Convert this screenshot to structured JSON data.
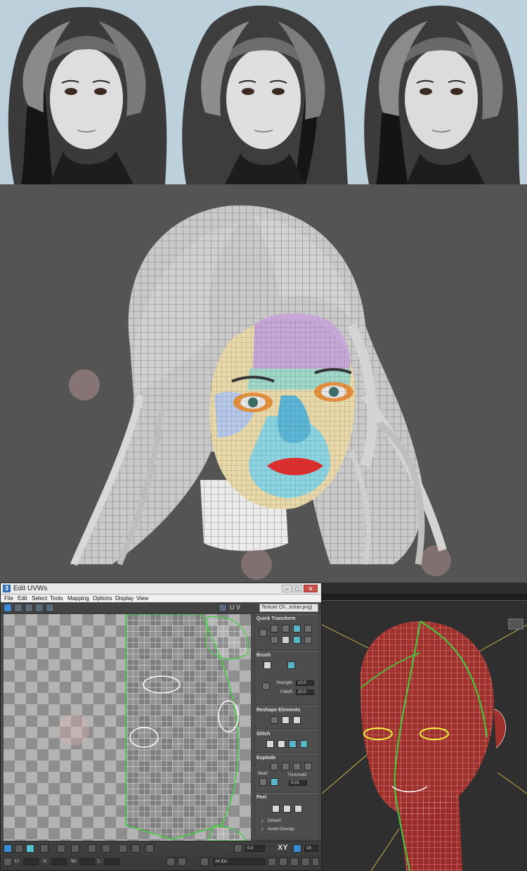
{
  "window": {
    "title": "Edit UVWs",
    "app_icon": "3",
    "buttons": {
      "minimize": "–",
      "maximize": "□",
      "close": "✕"
    }
  },
  "menu": [
    "File",
    "Edit",
    "Select",
    "Tools",
    "Mapping",
    "Options",
    "Display",
    "View"
  ],
  "toolbar": {
    "uv_label": "U V",
    "texture_select": "Texture Ch...ecker.png)"
  },
  "rollouts": {
    "quick_transform": "Quick Transform",
    "brush": "Brush",
    "strength_label": "Strength:",
    "strength_value": "10.0",
    "falloff_label": "Falloff:",
    "falloff_value": "20.0",
    "reshape": "Reshape Elements",
    "stitch": "Stitch",
    "explode": "Explode",
    "weld": "Weld",
    "threshold_label": "Threshold:",
    "threshold_value": "0.01",
    "peel": "Peel",
    "detach": "Detach",
    "avoid_overlap": "Avoid Overlap"
  },
  "bottom_bar": {
    "angle_value": "0.0",
    "xy_label": "XY",
    "grid_value": "16",
    "u_label": "U:",
    "v_label": "V:",
    "w_label": "W:",
    "l_label": "L:",
    "ids_select": "All IDs"
  },
  "colors": {
    "accent_blue": "#3a8bcf",
    "uv_line": "#ffffff",
    "seam_green": "#3fd13f",
    "head_red": "#a0302c"
  }
}
